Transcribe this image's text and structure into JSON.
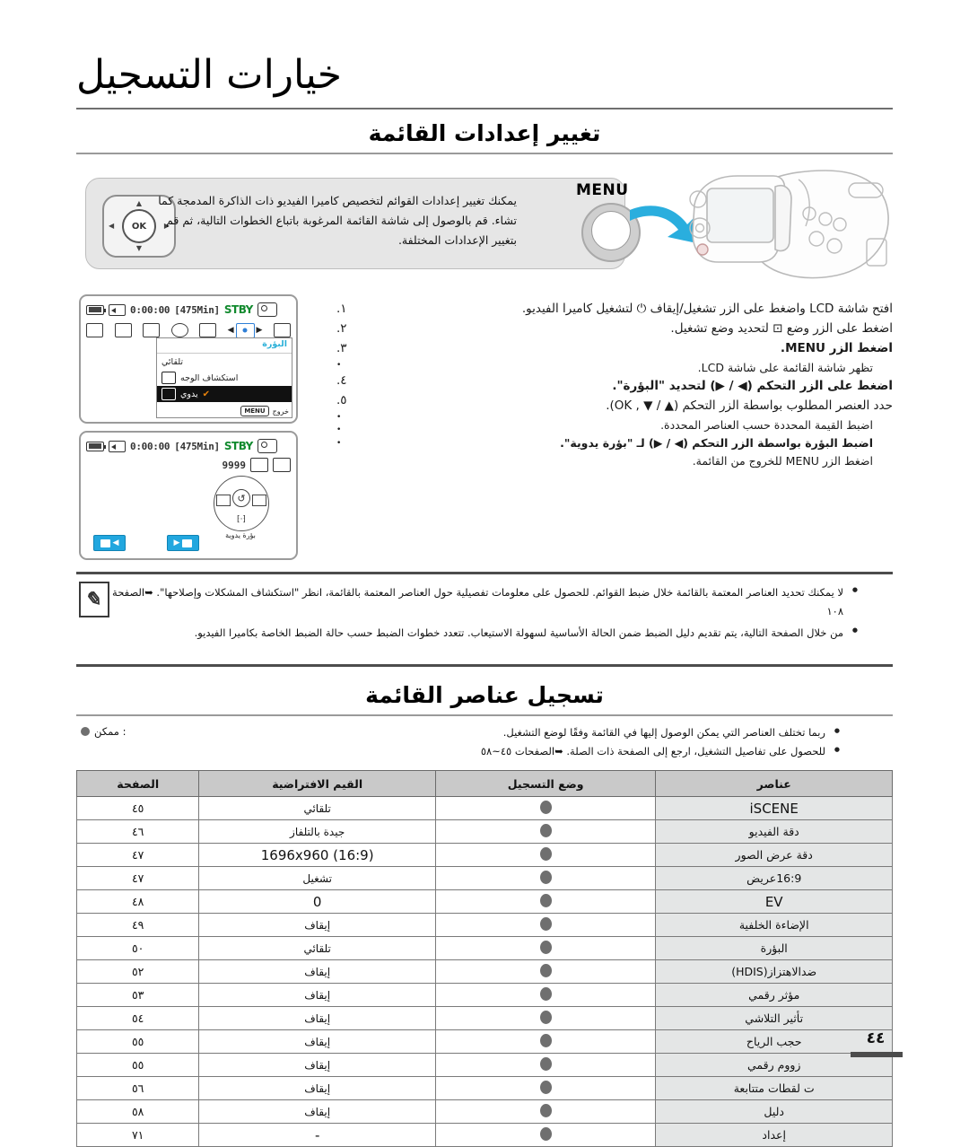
{
  "header": {
    "chapter_title": "خيارات التسجيل",
    "section_title": "تغيير إعدادات القائمة"
  },
  "intro": {
    "text": "يمكنك تغيير إعدادات القوائم لتخصيص كاميرا الفيديو ذات الذاكرة المدمجة كما تشاء. قم بالوصول إلى شاشة القائمة المرغوبة باتباع الخطوات التالية، ثم قم بتغيير الإعدادات المختلفة.",
    "menu_button_label": "MENU",
    "ok_label": "OK"
  },
  "steps": [
    {
      "num": "١.",
      "text": "افتح شاشة LCD واضغط على الزر تشغيل/إيقاف ⏻ لتشغيل كاميرا الفيديو."
    },
    {
      "num": "٢.",
      "text": "اضغط على الزر وضع ⊡ لتحديد وضع تشغيل."
    },
    {
      "num": "٣.",
      "text": "اضغط الزر MENU."
    },
    {
      "num": "•",
      "text": "تظهر شاشة القائمة على شاشة LCD."
    },
    {
      "num": "٤.",
      "text": "اضغط على الزر التحكم (◀ / ▶) لتحديد \"البؤرة\"."
    },
    {
      "num": "٥.",
      "text": "حدد العنصر المطلوب بواسطة الزر التحكم (▲ / ▼ , OK)."
    },
    {
      "num": "•",
      "text": "اضبط القيمة المحددة حسب العناصر المحددة."
    },
    {
      "num": "•",
      "text": "اضبط البؤرة بواسطة الزر التحكم (◀ / ▶) لـ \"بؤرة يدوية\"."
    },
    {
      "num": "•",
      "text": "اضغط الزر MENU للخروج من القائمة."
    }
  ],
  "lcd1": {
    "timecode": "0:00:00",
    "remaining": "[475Min]",
    "status": "STBY",
    "panel_header": "البؤرة",
    "panel_items": [
      {
        "label": "تلقائي",
        "selected": false,
        "has_icon": false
      },
      {
        "label": "استكشاف الوجه",
        "selected": false,
        "has_icon": true
      },
      {
        "label": "يدوي",
        "selected": true,
        "has_icon": true
      }
    ],
    "exit_label": "خروج",
    "exit_button": "MENU"
  },
  "lcd2": {
    "timecode": "0:00:00",
    "remaining": "[475Min]",
    "status": "STBY",
    "photo_counter": "9999",
    "dial_label": "بؤرة يدوية",
    "dial_center": "↺"
  },
  "notes": [
    "لا يمكنك تحديد العناصر المعتمة بالقائمة خلال ضبط القوائم. للحصول على معلومات تفصيلية حول العناصر المعتمة بالقائمة، انظر \"استكشاف المشكلات وإصلاحها\". ➥الصفحة ١٠٨",
    "من خلال الصفحة التالية، يتم تقديم دليل الضبط ضمن الحالة الأساسية لسهولة الاستيعاب. تتعدد خطوات الضبط حسب حالة الضبط الخاصة بكاميرا الفيديو."
  ],
  "section2": {
    "title": "تسجيل عناصر القائمة",
    "bullets": [
      "ربما تختلف العناصر التي يمكن الوصول إليها في القائمة وفقًا لوضع التشغيل.",
      "للحصول على تفاصيل التشغيل، ارجع إلى الصفحة ذات الصلة. ➥الصفحات ٤٥~٥٨"
    ],
    "legend": ": ممكن"
  },
  "table": {
    "headers": [
      "عناصر",
      "وضع التسجيل",
      "القيم الافتراضية",
      "الصفحة"
    ],
    "rows": [
      {
        "name": "iSCENE",
        "latin_name": true,
        "mode": "●",
        "default": "تلقائي",
        "latin_default": false,
        "page": "٤٥"
      },
      {
        "name": "دقة الفيديو",
        "latin_name": false,
        "mode": "●",
        "default": "جيدة بالتلفاز",
        "latin_default": false,
        "page": "٤٦"
      },
      {
        "name": "دقة عرض الصور",
        "latin_name": false,
        "mode": "●",
        "default": "1696x960 (16:9)",
        "latin_default": true,
        "page": "٤٧"
      },
      {
        "name": "16:9عريض",
        "latin_name": false,
        "mode": "●",
        "default": "تشغيل",
        "latin_default": false,
        "page": "٤٧"
      },
      {
        "name": "EV",
        "latin_name": true,
        "mode": "●",
        "default": "0",
        "latin_default": true,
        "page": "٤٨"
      },
      {
        "name": "الإضاءة الخلفية",
        "latin_name": false,
        "mode": "●",
        "default": "إيقاف",
        "latin_default": false,
        "page": "٤٩"
      },
      {
        "name": "البؤرة",
        "latin_name": false,
        "mode": "●",
        "default": "تلقائي",
        "latin_default": false,
        "page": "٥٠"
      },
      {
        "name": "ضدالاهتزاز(HDIS)",
        "latin_name": false,
        "mode": "●",
        "default": "إيقاف",
        "latin_default": false,
        "page": "٥٢"
      },
      {
        "name": "مؤثر رقمي",
        "latin_name": false,
        "mode": "●",
        "default": "إيقاف",
        "latin_default": false,
        "page": "٥٣"
      },
      {
        "name": "تأثير التلاشي",
        "latin_name": false,
        "mode": "●",
        "default": "إيقاف",
        "latin_default": false,
        "page": "٥٤"
      },
      {
        "name": "حجب الرياح",
        "latin_name": false,
        "mode": "●",
        "default": "إيقاف",
        "latin_default": false,
        "page": "٥٥"
      },
      {
        "name": "زووم رقمي",
        "latin_name": false,
        "mode": "●",
        "default": "إيقاف",
        "latin_default": false,
        "page": "٥٥"
      },
      {
        "name": "ت لقطات متتابعة",
        "latin_name": false,
        "mode": "●",
        "default": "إيقاف",
        "latin_default": false,
        "page": "٥٦"
      },
      {
        "name": "دليل",
        "latin_name": false,
        "mode": "●",
        "default": "إيقاف",
        "latin_default": false,
        "page": "٥٨"
      },
      {
        "name": "إعداد",
        "latin_name": false,
        "mode": "●",
        "default": "-",
        "latin_default": true,
        "page": "٧١"
      }
    ]
  },
  "page_number": "٤٤",
  "colors": {
    "accent_blue": "#22a7df",
    "status_green": "#118a2e",
    "panel_header": "#2ab0d8",
    "check_orange": "#e8820c",
    "table_header_bg": "#c9c9c9",
    "row_name_bg": "#e4e6e6"
  }
}
